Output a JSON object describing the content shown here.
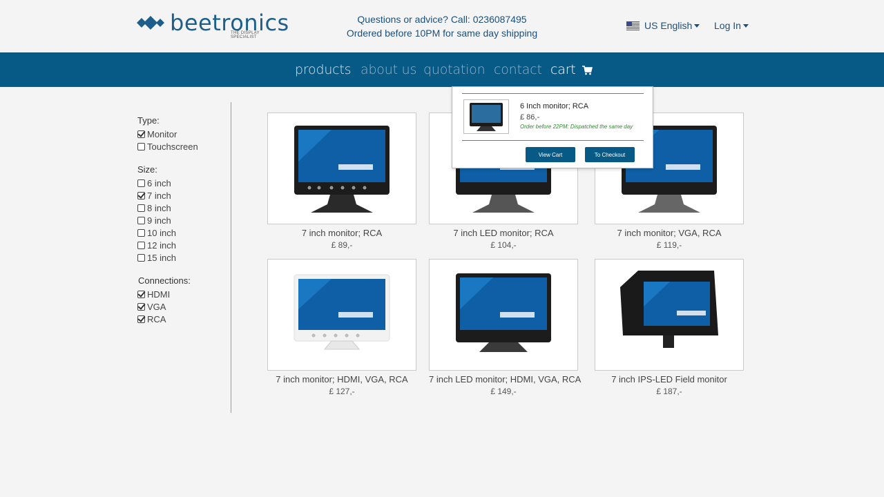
{
  "brand": {
    "name": "beetronics",
    "tagline": "THE DISPLAY SPECIALIST",
    "color": "#1d5f8a"
  },
  "header": {
    "contact_line1": "Questions or advice? Call: 0236087495",
    "contact_line2": "Ordered before 10PM for same day shipping",
    "language": "US English",
    "language_flag": "us-flag-icon",
    "login": "Log In"
  },
  "nav": {
    "background": "#075a86",
    "items": [
      {
        "label": "products"
      },
      {
        "label": "about us"
      },
      {
        "label": "quotation"
      },
      {
        "label": "contact"
      },
      {
        "label": "cart"
      }
    ]
  },
  "filters": {
    "type": {
      "title": "Type:",
      "options": [
        {
          "label": "Monitor",
          "checked": true
        },
        {
          "label": "Touchscreen",
          "checked": false
        }
      ]
    },
    "size": {
      "title": "Size:",
      "options": [
        {
          "label": "6 inch",
          "checked": false
        },
        {
          "label": "7 inch",
          "checked": true
        },
        {
          "label": "8 inch",
          "checked": false
        },
        {
          "label": "9 inch",
          "checked": false
        },
        {
          "label": "10 inch",
          "checked": false
        },
        {
          "label": "12 inch",
          "checked": false
        },
        {
          "label": "15 inch",
          "checked": false
        }
      ]
    },
    "connections": {
      "title": "Connections:",
      "options": [
        {
          "label": "HDMI",
          "checked": true
        },
        {
          "label": "VGA",
          "checked": true
        },
        {
          "label": "RCA",
          "checked": true
        }
      ]
    }
  },
  "products": [
    {
      "name": "7 inch monitor; RCA",
      "price": "£ 89,-"
    },
    {
      "name": "7 inch LED monitor; RCA",
      "price": "£ 104,-"
    },
    {
      "name": "7 inch monitor; VGA, RCA",
      "price": "£ 119,-"
    },
    {
      "name": "7 inch monitor; HDMI, VGA, RCA",
      "price": "£ 127,-"
    },
    {
      "name": "7 inch LED monitor; HDMI, VGA, RCA",
      "price": "£ 149,-"
    },
    {
      "name": "7 inch IPS-LED Field monitor",
      "price": "£ 187,-"
    }
  ],
  "cart_dropdown": {
    "item_name": "6 Inch monitor; RCA",
    "item_price": "£ 86,-",
    "shipping_note": "Order before 22PM: Dispatched the same day",
    "view_cart": "View Cart",
    "checkout": "To Checkout"
  }
}
